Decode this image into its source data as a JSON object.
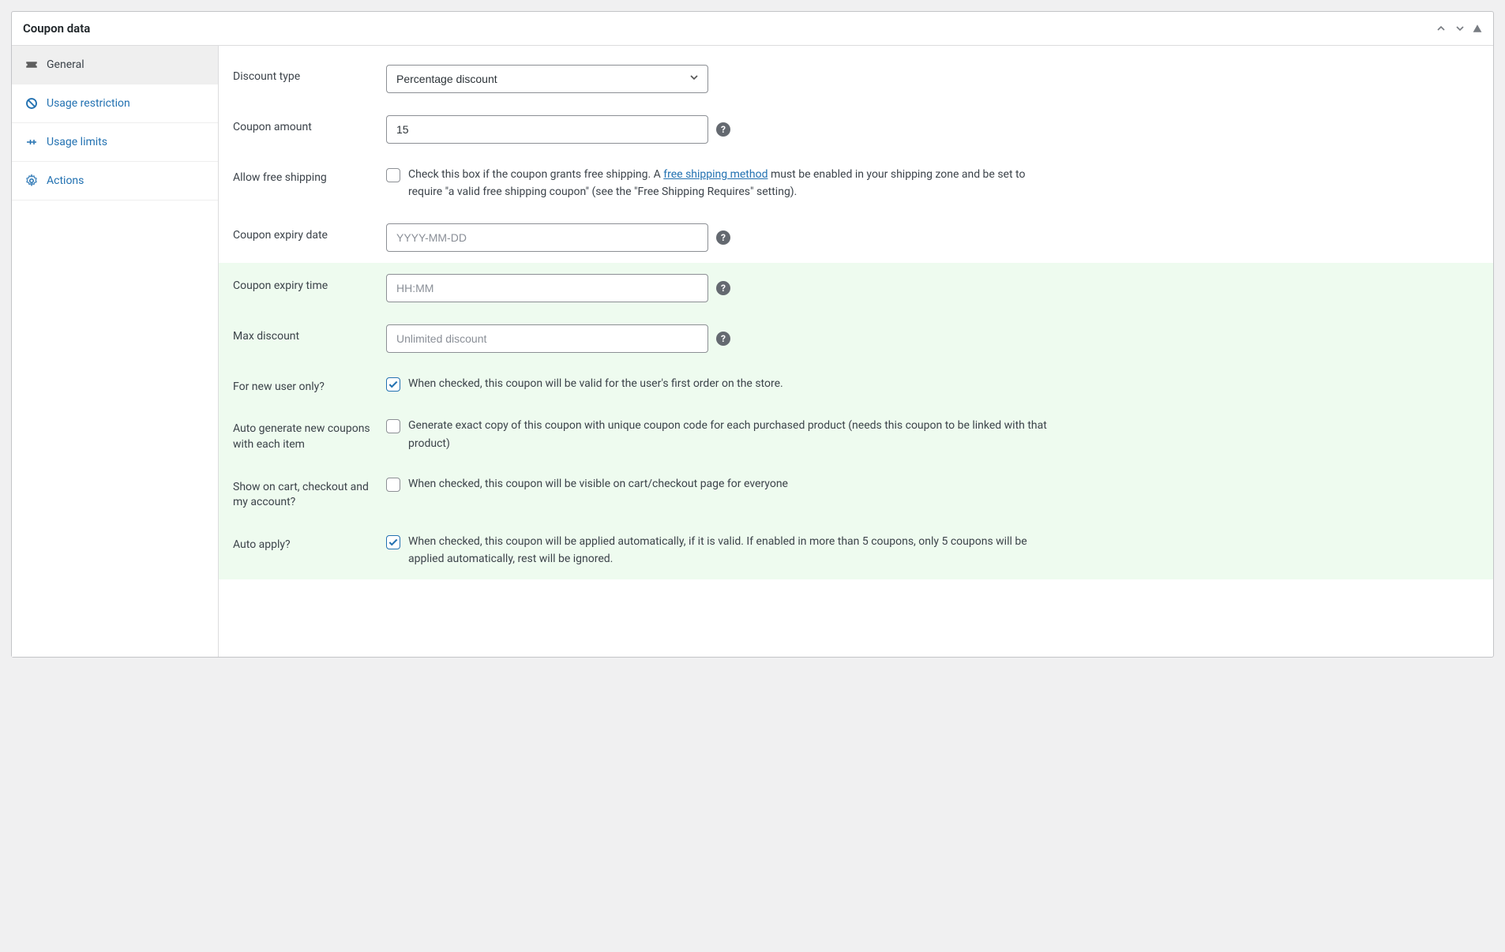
{
  "panel": {
    "title": "Coupon data"
  },
  "sidebar": {
    "items": [
      {
        "label": "General"
      },
      {
        "label": "Usage restriction"
      },
      {
        "label": "Usage limits"
      },
      {
        "label": "Actions"
      }
    ]
  },
  "form": {
    "discount_type": {
      "label": "Discount type",
      "value": "Percentage discount"
    },
    "coupon_amount": {
      "label": "Coupon amount",
      "value": "15"
    },
    "free_shipping": {
      "label": "Allow free shipping",
      "desc_before": "Check this box if the coupon grants free shipping. A ",
      "link_text": "free shipping method",
      "desc_after": " must be enabled in your shipping zone and be set to require \"a valid free shipping coupon\" (see the \"Free Shipping Requires\" setting).",
      "checked": false
    },
    "expiry_date": {
      "label": "Coupon expiry date",
      "placeholder": "YYYY-MM-DD"
    },
    "expiry_time": {
      "label": "Coupon expiry time",
      "placeholder": "HH:MM"
    },
    "max_discount": {
      "label": "Max discount",
      "placeholder": "Unlimited discount"
    },
    "new_user": {
      "label": "For new user only?",
      "desc": "When checked, this coupon will be valid for the user's first order on the store.",
      "checked": true
    },
    "auto_generate": {
      "label": "Auto generate new coupons with each item",
      "desc": "Generate exact copy of this coupon with unique coupon code for each purchased product (needs this coupon to be linked with that product)",
      "checked": false
    },
    "show_on_cart": {
      "label": "Show on cart, checkout and my account?",
      "desc": "When checked, this coupon will be visible on cart/checkout page for everyone",
      "checked": false
    },
    "auto_apply": {
      "label": "Auto apply?",
      "desc": "When checked, this coupon will be applied automatically, if it is valid. If enabled in more than 5 coupons, only 5 coupons will be applied automatically, rest will be ignored.",
      "checked": true
    }
  }
}
